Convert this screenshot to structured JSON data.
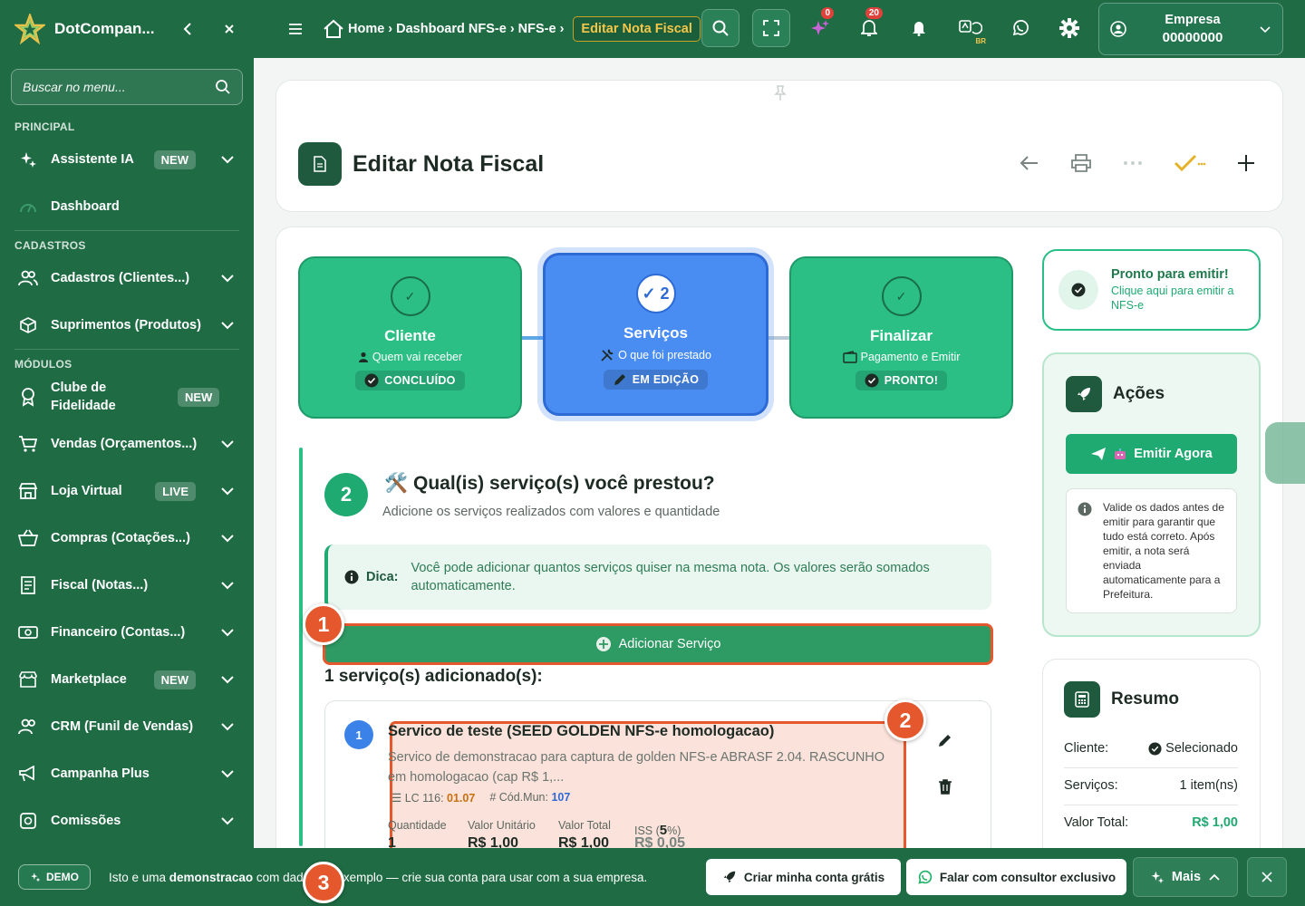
{
  "sidebar": {
    "brand": "DotCompan...",
    "search_placeholder": "Buscar no menu...",
    "sections": {
      "principal": "PRINCIPAL",
      "cadastros": "CADASTROS",
      "modulos": "MÓDULOS"
    },
    "items": {
      "assistente": {
        "label": "Assistente IA",
        "badge": "NEW"
      },
      "dashboard": {
        "label": "Dashboard"
      },
      "cadastros": {
        "label": "Cadastros (Clientes...)"
      },
      "suprimentos": {
        "label": "Suprimentos (Produtos)"
      },
      "clube": {
        "label": "Clube de Fidelidade",
        "badge": "NEW"
      },
      "vendas": {
        "label": "Vendas (Orçamentos...)"
      },
      "loja": {
        "label": "Loja Virtual",
        "badge": "LIVE"
      },
      "compras": {
        "label": "Compras (Cotações...)"
      },
      "fiscal": {
        "label": "Fiscal (Notas...)"
      },
      "financeiro": {
        "label": "Financeiro (Contas...)"
      },
      "marketplace": {
        "label": "Marketplace",
        "badge": "NEW"
      },
      "crm": {
        "label": "CRM (Funil de Vendas)"
      },
      "campanha": {
        "label": "Campanha Plus"
      },
      "comissoes": {
        "label": "Comissões"
      }
    }
  },
  "topbar": {
    "breadcrumbs": [
      "Home",
      "Dashboard NFS-e",
      "NFS-e"
    ],
    "current": "Editar Nota Fiscal",
    "ai_count": "0",
    "notif_count": "20",
    "lang": "BR",
    "company_name": "Empresa",
    "company_code": "00000000"
  },
  "page": {
    "title": "Editar Nota Fiscal"
  },
  "steps": [
    {
      "title": "Cliente",
      "subtitle": "Quem vai receber",
      "status": "CONCLUÍDO",
      "circle": "✓"
    },
    {
      "title": "Serviços",
      "subtitle": "O que foi prestado",
      "status": "EM EDIÇÃO",
      "circle": "✓ 2"
    },
    {
      "title": "Finalizar",
      "subtitle": "Pagamento e Emitir",
      "status": "PRONTO!",
      "circle": "✓"
    }
  ],
  "section": {
    "number": "2",
    "emoji": "🛠️",
    "title": "Qual(is) serviço(s) você prestou?",
    "subtitle": "Adicione os serviços realizados com valores e quantidade",
    "tip_label": "Dica:",
    "tip_text": "Você pode adicionar quantos serviços quiser na mesma nota. Os valores serão somados automaticamente.",
    "add_button": "Adicionar Serviço",
    "added_count": "1 serviço(s) adicionado(s):"
  },
  "service": {
    "index": "1",
    "title": "Servico de teste (SEED GOLDEN NFS-e homologacao)",
    "description": "Servico de demonstracao para captura de golden NFS-e ABRASF 2.04. RASCUNHO em homologacao (cap R$ 1,...",
    "lc_label": "LC 116:",
    "lc_value": "01.07",
    "mun_label": "Cód.Mun:",
    "mun_value": "107",
    "col_qty": "Quantidade",
    "col_unit": "Valor Unitário",
    "col_total": "Valor Total",
    "col_iss": "ISS",
    "iss_rate": "5",
    "iss_suffix": "%)",
    "qty": "1",
    "unit": "R$ 1,00",
    "total": "R$ 1,00",
    "iss": "R$ 0,05"
  },
  "ready": {
    "title": "Pronto para emitir!",
    "subtitle": "Clique aqui para emitir a NFS-e"
  },
  "acoes": {
    "title": "Ações",
    "emit_button": "Emitir Agora",
    "info": "Valide os dados antes de emitir para garantir que tudo está correto. Após emitir, a nota será enviada automaticamente para a Prefeitura."
  },
  "resumo": {
    "title": "Resumo",
    "cliente_label": "Cliente:",
    "cliente_value": "Selecionado",
    "servicos_label": "Serviços:",
    "servicos_value": "1 item(ns)",
    "total_label": "Valor Total:",
    "total_value": "R$ 1,00"
  },
  "bottom": {
    "demo_badge": "DEMO",
    "message_pre": "Isto e uma",
    "message_bold": "demonstracao",
    "message_post": "com dados de exemplo — crie sua conta para usar com a sua empresa.",
    "create_account": "Criar minha conta grátis",
    "consultant": "Falar com consultor exclusivo",
    "more": "Mais"
  },
  "annotations": [
    "1",
    "2",
    "3"
  ],
  "colors": {
    "brand_green": "#1e6b44",
    "accent_green": "#2bbf86",
    "active_blue": "#4a8df2",
    "highlight_orange": "#e5572c"
  }
}
